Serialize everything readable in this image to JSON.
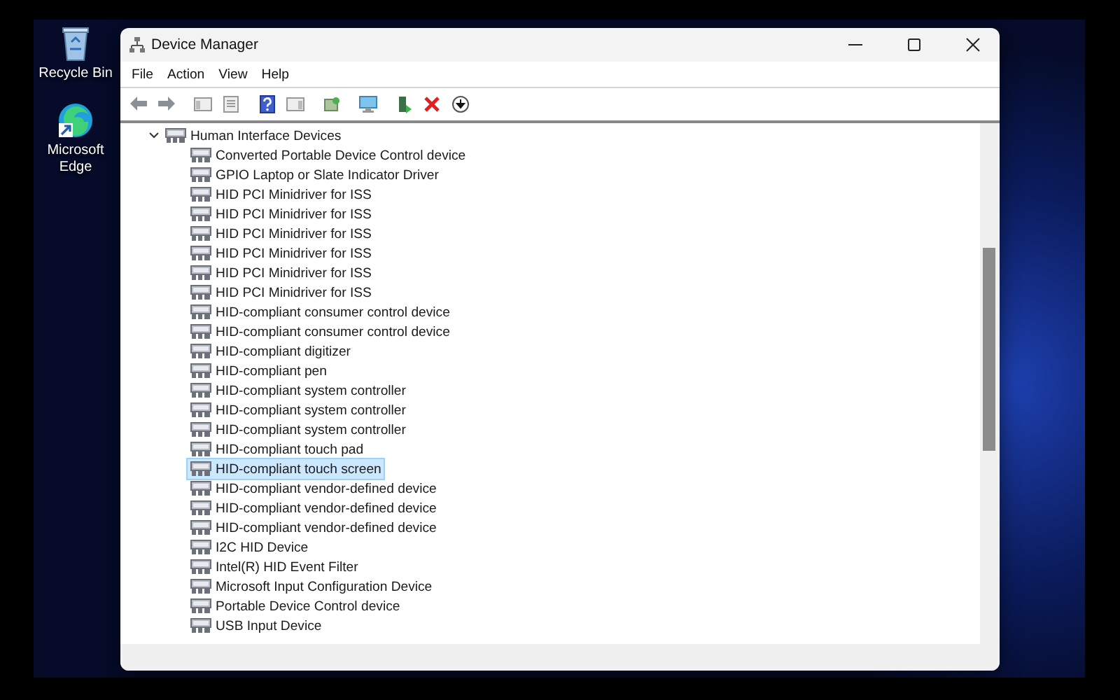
{
  "desktop_icons": [
    {
      "label": "Recycle Bin",
      "kind": "bin"
    },
    {
      "label": "Microsoft\nEdge",
      "kind": "edge"
    }
  ],
  "window": {
    "title": "Device Manager"
  },
  "menu": [
    "File",
    "Action",
    "View",
    "Help"
  ],
  "tree": {
    "label": "Human Interface Devices",
    "expanded": true,
    "children": [
      {
        "label": "Converted Portable Device Control device",
        "selected": false
      },
      {
        "label": "GPIO Laptop or Slate Indicator Driver",
        "selected": false
      },
      {
        "label": "HID PCI Minidriver for ISS",
        "selected": false
      },
      {
        "label": "HID PCI Minidriver for ISS",
        "selected": false
      },
      {
        "label": "HID PCI Minidriver for ISS",
        "selected": false
      },
      {
        "label": "HID PCI Minidriver for ISS",
        "selected": false
      },
      {
        "label": "HID PCI Minidriver for ISS",
        "selected": false
      },
      {
        "label": "HID PCI Minidriver for ISS",
        "selected": false
      },
      {
        "label": "HID-compliant consumer control device",
        "selected": false
      },
      {
        "label": "HID-compliant consumer control device",
        "selected": false
      },
      {
        "label": "HID-compliant digitizer",
        "selected": false
      },
      {
        "label": "HID-compliant pen",
        "selected": false
      },
      {
        "label": "HID-compliant system controller",
        "selected": false
      },
      {
        "label": "HID-compliant system controller",
        "selected": false
      },
      {
        "label": "HID-compliant system controller",
        "selected": false
      },
      {
        "label": "HID-compliant touch pad",
        "selected": false
      },
      {
        "label": "HID-compliant touch screen",
        "selected": true
      },
      {
        "label": "HID-compliant vendor-defined device",
        "selected": false
      },
      {
        "label": "HID-compliant vendor-defined device",
        "selected": false
      },
      {
        "label": "HID-compliant vendor-defined device",
        "selected": false
      },
      {
        "label": "I2C HID Device",
        "selected": false
      },
      {
        "label": "Intel(R) HID Event Filter",
        "selected": false
      },
      {
        "label": "Microsoft Input Configuration Device",
        "selected": false
      },
      {
        "label": "Portable Device Control device",
        "selected": false
      },
      {
        "label": "USB Input Device",
        "selected": false
      }
    ]
  }
}
